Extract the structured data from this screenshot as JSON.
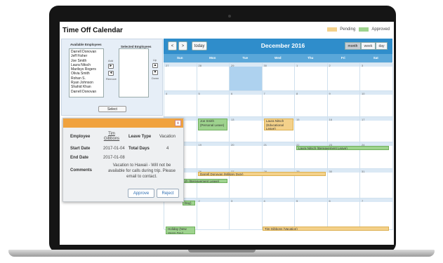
{
  "app": {
    "title": "Time Off Calendar"
  },
  "legend": {
    "pending": "Pending",
    "approved": "Approved",
    "pending_color": "#f4d18a",
    "approved_color": "#9ed38e"
  },
  "employees": {
    "available_label": "Available Employees",
    "selected_label": "Selected Employees",
    "list": [
      "Darrell Donovan",
      "Jeff Fisher",
      "Joe Smith",
      "Laura Nitsch",
      "Marilsys Rogers",
      "Olivia Smith",
      "Rohan S.",
      "Ryan Johnson",
      "Shahid Khan",
      "Darrell Donovan"
    ],
    "add_label": "Add",
    "add_icon": "►",
    "remove_label": "Remove",
    "remove_icon": "◄",
    "up_label": "Up",
    "up_icon": "▲",
    "down_label": "Down",
    "down_icon": "▼",
    "select_label": "Select"
  },
  "calendar": {
    "month_title": "December 2016",
    "prev_label": "<",
    "next_label": ">",
    "today_label": "today",
    "views": [
      "month",
      "week",
      "day"
    ],
    "active_view": "month",
    "days_of_week": [
      "Sun",
      "Mon",
      "Tue",
      "Wed",
      "Thu",
      "Fri",
      "Sat"
    ],
    "weeks": [
      [
        "27",
        "28",
        "29",
        "30",
        "1",
        "2",
        "3"
      ],
      [
        "4",
        "5",
        "6",
        "7",
        "8",
        "9",
        "10"
      ],
      [
        "11",
        "12",
        "13",
        "14",
        "15",
        "16",
        "17"
      ],
      [
        "18",
        "19",
        "20",
        "21",
        "22",
        "23",
        "24"
      ],
      [
        "25",
        "26",
        "27",
        "28",
        "29",
        "30",
        "31"
      ],
      [
        "1",
        "2",
        "3",
        "4",
        "5",
        "6",
        "7"
      ]
    ],
    "events": [
      {
        "text": "Joe Smith (Personal Leave)",
        "status": "approved"
      },
      {
        "text": "Laura Nitsch (Educational Leave)",
        "status": "pending"
      },
      {
        "text": "Laura Nitsch (Bereavement Leave)",
        "status": "approved"
      },
      {
        "text": "Darrell Donovan (Military Duty)",
        "status": "pending"
      },
      {
        "text": "ch (Bereavement Leave)",
        "status": "approved"
      },
      {
        "text": "Day)",
        "status": "approved"
      },
      {
        "text": "Holiday (New Years Day)",
        "status": "approved"
      },
      {
        "text": "Tim Gibbons (Vacation)",
        "status": "pending"
      }
    ]
  },
  "popup": {
    "close_icon": "x",
    "employee_label": "Employee",
    "employee_value": "Tim Gibbons",
    "leave_type_label": "Leave Type",
    "leave_type_value": "Vacation",
    "start_label": "Start Date",
    "start_value": "2017-01-04",
    "total_days_label": "Total Days",
    "total_days_value": "4",
    "end_label": "End Date",
    "end_value": "2017-01-08",
    "comments_label": "Comments",
    "comments_value": "Vacation to Hawaii - Will not be available for calls during trip. Please email to contact.",
    "approve_label": "Approve",
    "reject_label": "Reject"
  }
}
